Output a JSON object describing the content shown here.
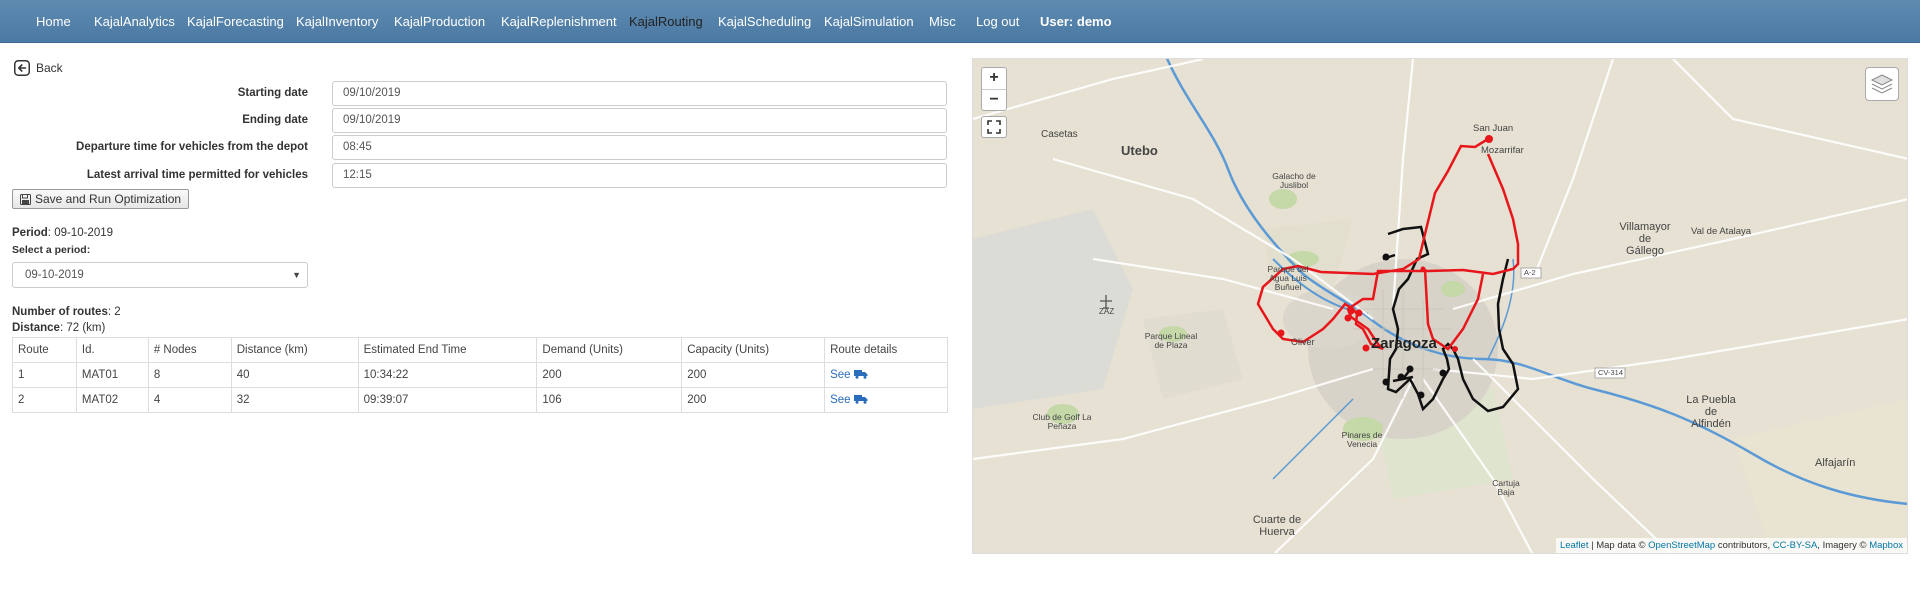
{
  "nav": {
    "items": [
      {
        "label": "Home",
        "active": false
      },
      {
        "label": "KajalAnalytics",
        "active": false
      },
      {
        "label": "KajalForecasting",
        "active": false
      },
      {
        "label": "KajalInventory",
        "active": false
      },
      {
        "label": "KajalProduction",
        "active": false
      },
      {
        "label": "KajalReplenishment",
        "active": false
      },
      {
        "label": "KajalRouting",
        "active": true
      },
      {
        "label": "KajalScheduling",
        "active": false
      },
      {
        "label": "KajalSimulation",
        "active": false
      },
      {
        "label": "Misc",
        "active": false
      },
      {
        "label": "Log out",
        "active": false
      }
    ],
    "user_label": "User:",
    "user_name": "demo"
  },
  "back_label": "Back",
  "form": {
    "start_label": "Starting date",
    "start_value": "09/10/2019",
    "end_label": "Ending date",
    "end_value": "09/10/2019",
    "departure_label": "Departure time for vehicles from the depot",
    "departure_value": "08:45",
    "arrival_label": "Latest arrival time permitted for vehicles",
    "arrival_value": "12:15",
    "save_label": "Save and Run Optimization"
  },
  "period": {
    "label": "Period",
    "value": "09-10-2019",
    "select_label": "Select a period:",
    "selected": "09-10-2019"
  },
  "summary": {
    "routes_label": "Number of routes",
    "routes_value": "2",
    "distance_label": "Distance",
    "distance_value": "72 (km)"
  },
  "table": {
    "headers": [
      "Route",
      "Id.",
      "# Nodes",
      "Distance (km)",
      "Estimated End Time",
      "Demand (Units)",
      "Capacity (Units)",
      "Route details"
    ],
    "rows": [
      {
        "route": "1",
        "id": "MAT01",
        "nodes": "8",
        "distance": "40",
        "end_time": "10:34:22",
        "demand": "200",
        "capacity": "200",
        "details": "See"
      },
      {
        "route": "2",
        "id": "MAT02",
        "nodes": "4",
        "distance": "32",
        "end_time": "09:39:07",
        "demand": "106",
        "capacity": "200",
        "details": "See"
      }
    ]
  },
  "map": {
    "labels": {
      "utebo": "Utebo",
      "casetas": "Casetas",
      "zaragoza": "Zaragoza",
      "villamayor1": "Villamayor",
      "villamayor2": "de",
      "villamayor3": "Gállego",
      "puebla1": "La Puebla",
      "puebla2": "de",
      "puebla3": "Alfindén",
      "alfajarin": "Alfajarín",
      "cuarte1": "Cuarte de",
      "cuarte2": "Huerva",
      "valdeatalaya": "Val de Atalaya",
      "sanjuan": "San Juan",
      "mozarrifar": "Mozarrifar",
      "zaz": "ZAZ",
      "parque_agua1": "Parque del",
      "parque_agua2": "Agua Luis",
      "parque_agua3": "Buñuel",
      "parque_plaza1": "Parque Lineal",
      "parque_plaza2": "de Plaza",
      "club_golf1": "Club de Golf La",
      "club_golf2": "Peñaza",
      "pinares1": "Pinares de",
      "pinares2": "Venecia",
      "galacho1": "Galacho de",
      "galacho2": "Juslibol",
      "oliver": "Oliver",
      "cartuja1": "Cartuja",
      "cartuja2": "Baja",
      "a2": "A-2",
      "cv314": "CV-314"
    },
    "attribution": {
      "leaflet": "Leaflet",
      "mapdata": "| Map data ©",
      "osm": "OpenStreetMap",
      "contributors": "contributors,",
      "ccbysa": "CC-BY-SA",
      "imagery": ", Imagery ©",
      "mapbox": "Mapbox"
    },
    "route_colors": {
      "route1": "#e8161b",
      "route2": "#111111"
    },
    "river_color": "#5c9ad6"
  }
}
